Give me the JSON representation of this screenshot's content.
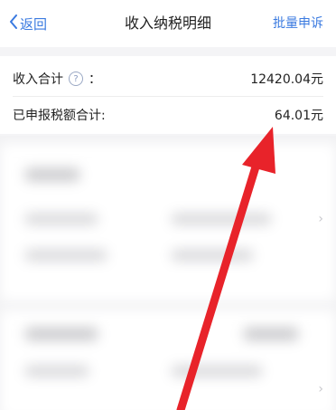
{
  "nav": {
    "back_label": "返回",
    "title": "收入纳税明细",
    "appeal_label": "批量申诉"
  },
  "summary": {
    "income_total_label": "收入合计",
    "income_total_colon": "：",
    "income_total_value": "12420.04元",
    "declared_tax_label": "已申报税额合计:",
    "declared_tax_value": "64.01元"
  },
  "colors": {
    "accent": "#3a7ae0",
    "arrow": "#e8232a"
  },
  "icons": {
    "back": "chevron-left-icon",
    "help": "question-circle-icon",
    "row_chevron": "chevron-right-icon"
  }
}
